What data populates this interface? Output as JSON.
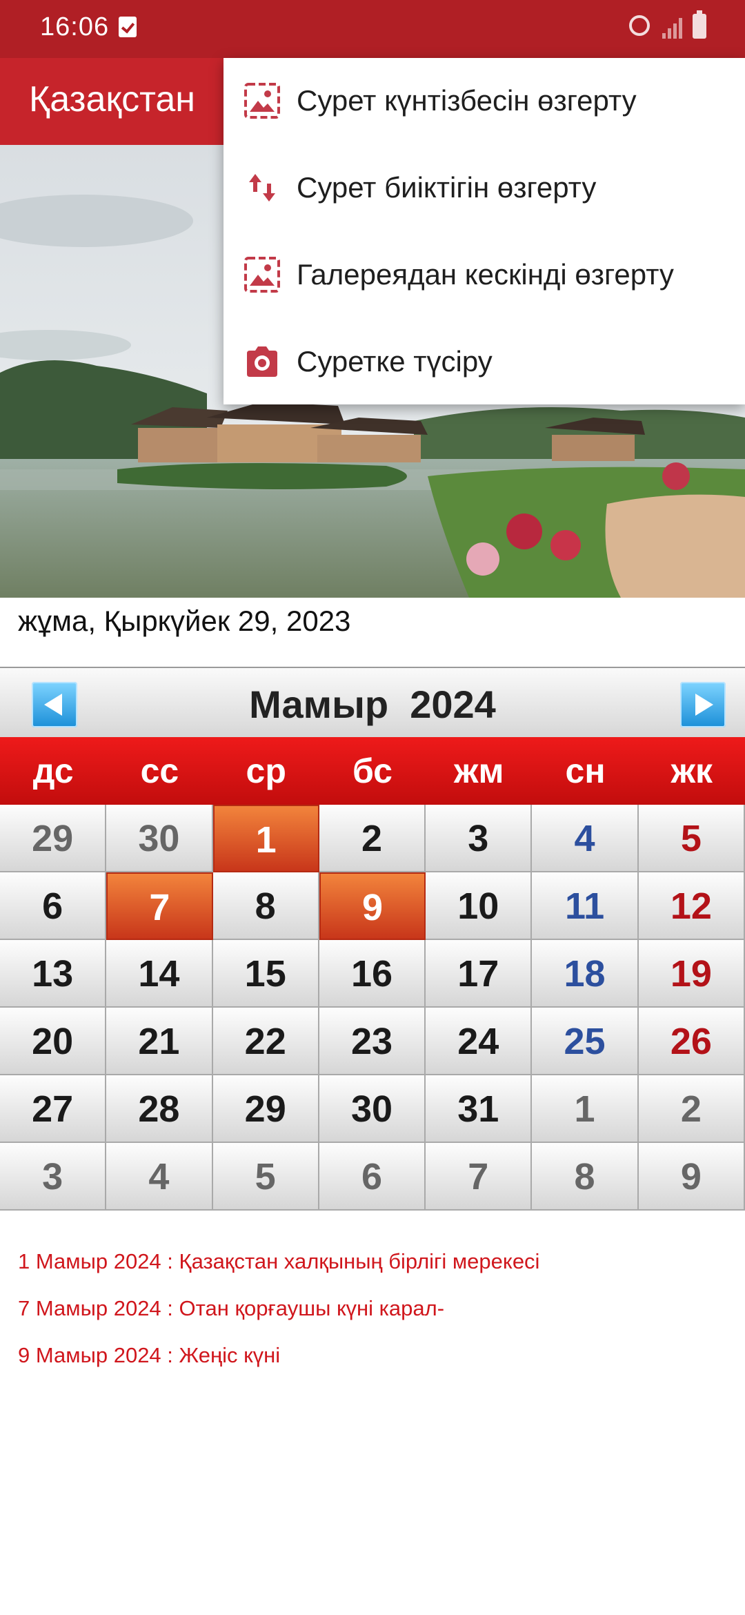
{
  "status_bar": {
    "time": "16:06",
    "icons": [
      "checkbox-notification-icon",
      "alarm-icon",
      "signal-icon",
      "battery-icon"
    ]
  },
  "app_bar": {
    "title": "Қазақстан"
  },
  "current_date": "жұма, Қыркүйек 29, 2023",
  "calendar": {
    "title": "Мамыр  2024",
    "prev_icon": "arrow-left-icon",
    "next_icon": "arrow-right-icon",
    "weekdays": [
      "дс",
      "сс",
      "ср",
      "бс",
      "жм",
      "сн",
      "жк"
    ],
    "weeks": [
      [
        {
          "d": "29",
          "t": "other"
        },
        {
          "d": "30",
          "t": "other"
        },
        {
          "d": "1",
          "t": "holiday"
        },
        {
          "d": "2",
          "t": ""
        },
        {
          "d": "3",
          "t": ""
        },
        {
          "d": "4",
          "t": "sat"
        },
        {
          "d": "5",
          "t": "sun"
        }
      ],
      [
        {
          "d": "6",
          "t": ""
        },
        {
          "d": "7",
          "t": "holiday"
        },
        {
          "d": "8",
          "t": ""
        },
        {
          "d": "9",
          "t": "holiday"
        },
        {
          "d": "10",
          "t": ""
        },
        {
          "d": "11",
          "t": "sat"
        },
        {
          "d": "12",
          "t": "sun"
        }
      ],
      [
        {
          "d": "13",
          "t": ""
        },
        {
          "d": "14",
          "t": ""
        },
        {
          "d": "15",
          "t": ""
        },
        {
          "d": "16",
          "t": ""
        },
        {
          "d": "17",
          "t": ""
        },
        {
          "d": "18",
          "t": "sat"
        },
        {
          "d": "19",
          "t": "sun"
        }
      ],
      [
        {
          "d": "20",
          "t": ""
        },
        {
          "d": "21",
          "t": ""
        },
        {
          "d": "22",
          "t": ""
        },
        {
          "d": "23",
          "t": ""
        },
        {
          "d": "24",
          "t": ""
        },
        {
          "d": "25",
          "t": "sat"
        },
        {
          "d": "26",
          "t": "sun"
        }
      ],
      [
        {
          "d": "27",
          "t": ""
        },
        {
          "d": "28",
          "t": ""
        },
        {
          "d": "29",
          "t": ""
        },
        {
          "d": "30",
          "t": ""
        },
        {
          "d": "31",
          "t": ""
        },
        {
          "d": "1",
          "t": "other"
        },
        {
          "d": "2",
          "t": "other"
        }
      ],
      [
        {
          "d": "3",
          "t": "other"
        },
        {
          "d": "4",
          "t": "other"
        },
        {
          "d": "5",
          "t": "other"
        },
        {
          "d": "6",
          "t": "other"
        },
        {
          "d": "7",
          "t": "other"
        },
        {
          "d": "8",
          "t": "other"
        },
        {
          "d": "9",
          "t": "other"
        }
      ]
    ]
  },
  "holidays": [
    "1 Мамыр 2024 : Қазақстан халқының бірлігі мерекесі",
    "7 Мамыр 2024 : Отан қорғаушы күні карал-",
    "9 Мамыр 2024 : Жеңіс күні"
  ],
  "menu": {
    "items": [
      {
        "label": "Сурет күнтізбесін өзгерту",
        "icon": "image-icon"
      },
      {
        "label": "Сурет биіктігін өзгерту",
        "icon": "swap-vertical-icon"
      },
      {
        "label": "Галереядан кескінді өзгерту",
        "icon": "image-icon"
      },
      {
        "label": "Суретке түсіру",
        "icon": "camera-icon"
      }
    ]
  },
  "colors": {
    "status_bar": "#b01f25",
    "app_bar": "#c6242b",
    "weekday_header": "#e01414",
    "holiday_cell": "#e2602c",
    "holiday_text": "#d0161c",
    "saturday": "#2c4f9e",
    "sunday": "#b31218"
  }
}
